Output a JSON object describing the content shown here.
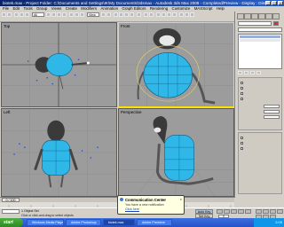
{
  "window": {
    "title": "biotek.max - Project Folder: C:\\Documents and Settings\\IK\\My Documents\\3dsmax - Autodesk 3ds Max 2008 - Completed/Preview - Display : Direct 3D",
    "controls": [
      "_",
      "□",
      "×"
    ]
  },
  "menu": [
    "File",
    "Edit",
    "Tools",
    "Group",
    "Views",
    "Create",
    "Modifiers",
    "Animation",
    "Graph Editors",
    "Rendering",
    "Customize",
    "MAXScript",
    "Help"
  ],
  "toolbar": {
    "selection_filter": "All",
    "view_dropdown": "View"
  },
  "viewports": [
    {
      "label": "Top"
    },
    {
      "label": "Front"
    },
    {
      "label": "Left"
    },
    {
      "label": "Perspective"
    }
  ],
  "time_slider": {
    "text": "0 / 100"
  },
  "status": {
    "selection": "1 Object Sel",
    "prompt": "Click or click-and-drag to select objects",
    "x_label": "X:",
    "y_label": "Y:",
    "z_label": "Z:",
    "grid": "Grid = 10.0",
    "auto_key": "Auto Key",
    "set_key": "Set Key",
    "frame": "0"
  },
  "balloon": {
    "title": "Communication Center",
    "line1": "You have a new notification",
    "line2": "Click here"
  },
  "taskbar": {
    "start_label": "start",
    "tasks": [
      "Windows Media Player",
      "Adobe Photoshop",
      "biotek.max",
      "Adobe Premiere"
    ],
    "clock": "2:05"
  },
  "colors": {
    "active_viewport": "#ffe000",
    "model_body": "#2fb7e8",
    "taskbar": "#2452c8"
  }
}
